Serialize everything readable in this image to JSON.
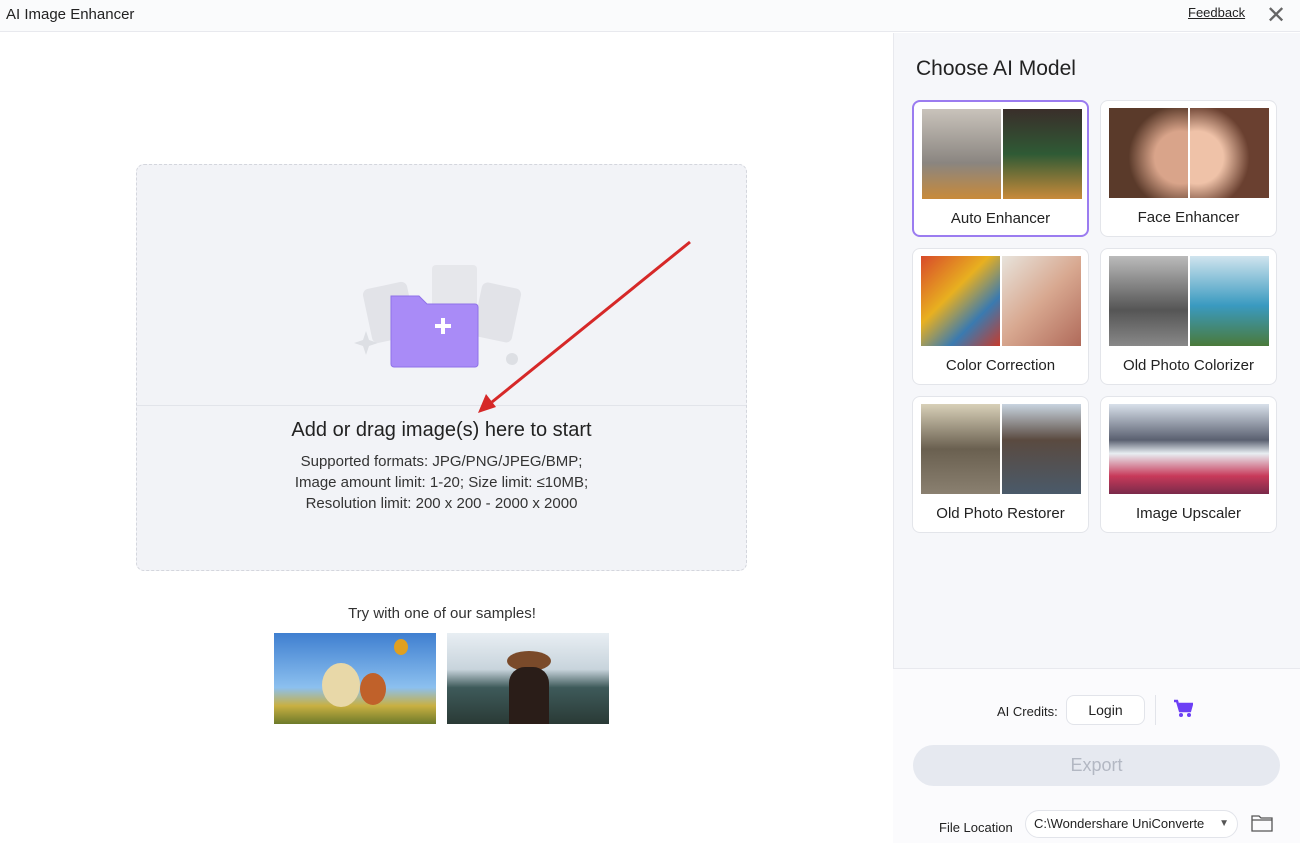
{
  "window": {
    "title": "AI Image Enhancer",
    "feedback": "Feedback",
    "close_icon": "close-icon"
  },
  "upload": {
    "title": "Add or drag image(s) here to start",
    "formats": "Supported formats: JPG/PNG/JPEG/BMP;",
    "limits": "Image amount limit: 1-20; Size limit: ≤10MB;",
    "resolution": "Resolution limit: 200 x 200 - 2000 x 2000"
  },
  "samples": {
    "label": "Try with one of our samples!"
  },
  "sidebar": {
    "title": "Choose AI Model",
    "models": [
      {
        "label": "Auto Enhancer",
        "selected": true
      },
      {
        "label": "Face Enhancer"
      },
      {
        "label": "Color Correction"
      },
      {
        "label": "Old Photo Colorizer"
      },
      {
        "label": "Old Photo Restorer"
      },
      {
        "label": "Image Upscaler"
      }
    ]
  },
  "footer": {
    "credits_label": "AI Credits:",
    "login": "Login",
    "export": "Export",
    "file_location_label": "File Location",
    "file_location": "C:\\Wondershare UniConverte"
  },
  "colors": {
    "accent": "#9b7cf0",
    "cart": "#6c3ff5",
    "arrow": "#d62828"
  }
}
